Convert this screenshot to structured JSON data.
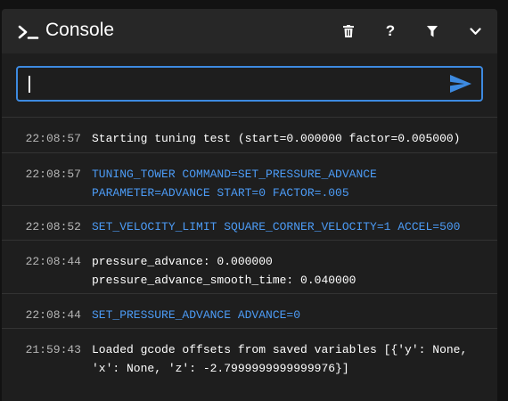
{
  "header": {
    "title": "Console",
    "help_label": "?",
    "icons": [
      "terminal-icon",
      "trash-icon",
      "help-icon",
      "filter-icon",
      "chevron-down-icon"
    ]
  },
  "input": {
    "value": "",
    "placeholder": ""
  },
  "colors": {
    "accent": "#3d8ae0",
    "command_text": "#4c9bf5",
    "panel": "#1e1e1e",
    "header": "#272727"
  },
  "log": [
    {
      "time": "22:08:57",
      "type": "info",
      "text": "Starting tuning test (start=0.000000 factor=0.005000)"
    },
    {
      "time": "22:08:57",
      "type": "cmd",
      "text": "TUNING_TOWER COMMAND=SET_PRESSURE_ADVANCE\nPARAMETER=ADVANCE START=0 FACTOR=.005"
    },
    {
      "time": "22:08:52",
      "type": "cmd",
      "text": "SET_VELOCITY_LIMIT SQUARE_CORNER_VELOCITY=1 ACCEL=500"
    },
    {
      "time": "22:08:44",
      "type": "info",
      "text": "pressure_advance: 0.000000\npressure_advance_smooth_time: 0.040000"
    },
    {
      "time": "22:08:44",
      "type": "cmd",
      "text": "SET_PRESSURE_ADVANCE ADVANCE=0"
    },
    {
      "time": "21:59:43",
      "type": "info",
      "text": "Loaded gcode offsets from saved variables [{'y': None,\n'x': None, 'z': -2.7999999999999976}]"
    }
  ]
}
